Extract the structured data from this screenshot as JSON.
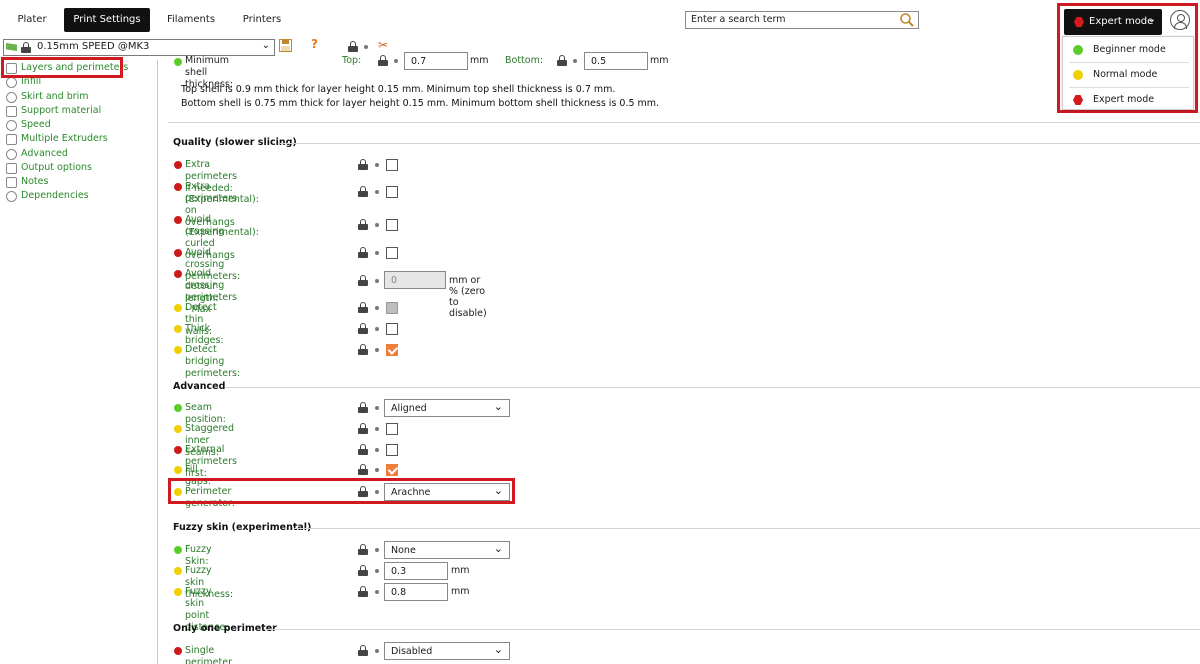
{
  "tabs": [
    "Plater",
    "Print Settings",
    "Filaments",
    "Printers"
  ],
  "active_tab": "Print Settings",
  "search": {
    "placeholder": "Enter a search term"
  },
  "mode": {
    "current": "Expert mode",
    "options": [
      {
        "label": "Beginner mode",
        "color": "#5acc2a"
      },
      {
        "label": "Normal mode",
        "color": "#f0d000"
      },
      {
        "label": "Expert mode",
        "color": "#d41a1a"
      }
    ]
  },
  "profile": {
    "name": "0.15mm SPEED @MK3"
  },
  "sidebar": {
    "items": [
      {
        "label": "Layers and perimeters",
        "icon": "layers-icon"
      },
      {
        "label": "Infill",
        "icon": "infill-icon"
      },
      {
        "label": "Skirt and brim",
        "icon": "skirt-icon"
      },
      {
        "label": "Support material",
        "icon": "support-icon"
      },
      {
        "label": "Speed",
        "icon": "speed-icon"
      },
      {
        "label": "Multiple Extruders",
        "icon": "extruders-icon"
      },
      {
        "label": "Advanced",
        "icon": "advanced-icon"
      },
      {
        "label": "Output options",
        "icon": "output-icon"
      },
      {
        "label": "Notes",
        "icon": "notes-icon"
      },
      {
        "label": "Dependencies",
        "icon": "dependencies-icon"
      }
    ]
  },
  "shell": {
    "label": "Minimum shell thickness:",
    "top_label": "Top:",
    "top_value": "0.7",
    "bottom_label": "Bottom:",
    "bottom_value": "0.5",
    "unit": "mm",
    "info_top": "Top shell is 0.9 mm thick for layer height 0.15 mm. Minimum top shell thickness is 0.7 mm.",
    "info_bottom": "Bottom shell is 0.75 mm thick for layer height 0.15 mm. Minimum bottom shell thickness is 0.5 mm."
  },
  "quality": {
    "title": "Quality (slower slicing)",
    "rows": [
      {
        "label": "Extra perimeters if needed:"
      },
      {
        "label": "Extra perimeters on overhangs",
        "label2": "(Experimental):"
      },
      {
        "label": "Avoid crossing curled overhangs",
        "label2": "(Experimental):"
      },
      {
        "label": "Avoid crossing perimeters:"
      },
      {
        "label": "Avoid crossing perimeters - Max",
        "label2": "detour length:",
        "value": "0",
        "unit": "mm or % (zero to disable)"
      },
      {
        "label": "Detect thin walls:"
      },
      {
        "label": "Thick bridges:"
      },
      {
        "label": "Detect bridging perimeters:"
      }
    ]
  },
  "advanced": {
    "title": "Advanced",
    "rows": [
      {
        "label": "Seam position:",
        "value": "Aligned"
      },
      {
        "label": "Staggered inner seams:"
      },
      {
        "label": "External perimeters first:"
      },
      {
        "label": "Fill gaps:"
      },
      {
        "label": "Perimeter generator:",
        "value": "Arachne"
      }
    ]
  },
  "fuzzy": {
    "title": "Fuzzy skin (experimental)",
    "rows": [
      {
        "label": "Fuzzy Skin:",
        "value": "None"
      },
      {
        "label": "Fuzzy skin thickness:",
        "value": "0.3",
        "unit": "mm"
      },
      {
        "label": "Fuzzy skin point distance:",
        "value": "0.8",
        "unit": "mm"
      }
    ]
  },
  "one_perimeter": {
    "title": "Only one perimeter",
    "rows": [
      {
        "label": "Single perimeter on top surfaces:",
        "value": "Disabled"
      }
    ]
  }
}
